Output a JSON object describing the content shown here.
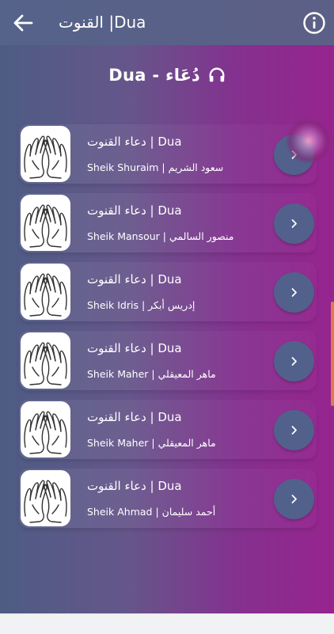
{
  "appbar": {
    "title": "القنوت |Dua",
    "back_icon": "arrow-left-icon",
    "info_icon": "info-circle-icon"
  },
  "section": {
    "title": "Dua - دُعَاء",
    "icon": "headphones-icon"
  },
  "items": [
    {
      "title": "دعاء القنوت | Dua",
      "reciter": "Sheik Shuraim | سعود الشريم"
    },
    {
      "title": "دعاء القنوت | Dua",
      "reciter": "Sheik Mansour | منصور السالمي"
    },
    {
      "title": "دعاء القنوت | Dua",
      "reciter": "Sheik Idris | إدريس أبكر"
    },
    {
      "title": "دعاء القنوت | Dua",
      "reciter": "Sheik Maher | ماهر المعيقلي"
    },
    {
      "title": "دعاء القنوت | Dua",
      "reciter": "Sheik Maher | ماهر المعيقلي"
    },
    {
      "title": "دعاء القنوت | Dua",
      "reciter": "Sheik Ahmad | أحمد سليمان"
    }
  ],
  "colors": {
    "gradient_start": "#4d5c84",
    "gradient_end": "#97248f",
    "button": "#51618b",
    "scroll_indicator": "#e0794d"
  }
}
